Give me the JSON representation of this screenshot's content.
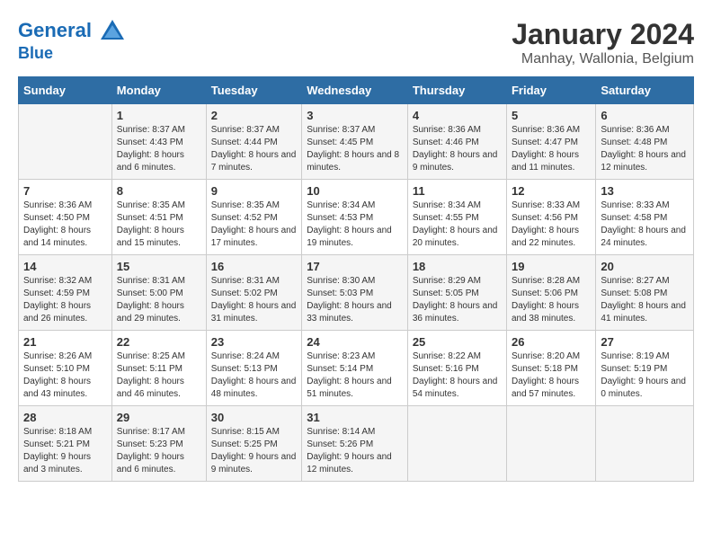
{
  "header": {
    "logo_line1": "General",
    "logo_line2": "Blue",
    "month_year": "January 2024",
    "location": "Manhay, Wallonia, Belgium"
  },
  "days_of_week": [
    "Sunday",
    "Monday",
    "Tuesday",
    "Wednesday",
    "Thursday",
    "Friday",
    "Saturday"
  ],
  "weeks": [
    [
      {
        "day": "",
        "sunrise": "",
        "sunset": "",
        "daylight": ""
      },
      {
        "day": "1",
        "sunrise": "Sunrise: 8:37 AM",
        "sunset": "Sunset: 4:43 PM",
        "daylight": "Daylight: 8 hours and 6 minutes."
      },
      {
        "day": "2",
        "sunrise": "Sunrise: 8:37 AM",
        "sunset": "Sunset: 4:44 PM",
        "daylight": "Daylight: 8 hours and 7 minutes."
      },
      {
        "day": "3",
        "sunrise": "Sunrise: 8:37 AM",
        "sunset": "Sunset: 4:45 PM",
        "daylight": "Daylight: 8 hours and 8 minutes."
      },
      {
        "day": "4",
        "sunrise": "Sunrise: 8:36 AM",
        "sunset": "Sunset: 4:46 PM",
        "daylight": "Daylight: 8 hours and 9 minutes."
      },
      {
        "day": "5",
        "sunrise": "Sunrise: 8:36 AM",
        "sunset": "Sunset: 4:47 PM",
        "daylight": "Daylight: 8 hours and 11 minutes."
      },
      {
        "day": "6",
        "sunrise": "Sunrise: 8:36 AM",
        "sunset": "Sunset: 4:48 PM",
        "daylight": "Daylight: 8 hours and 12 minutes."
      }
    ],
    [
      {
        "day": "7",
        "sunrise": "Sunrise: 8:36 AM",
        "sunset": "Sunset: 4:50 PM",
        "daylight": "Daylight: 8 hours and 14 minutes."
      },
      {
        "day": "8",
        "sunrise": "Sunrise: 8:35 AM",
        "sunset": "Sunset: 4:51 PM",
        "daylight": "Daylight: 8 hours and 15 minutes."
      },
      {
        "day": "9",
        "sunrise": "Sunrise: 8:35 AM",
        "sunset": "Sunset: 4:52 PM",
        "daylight": "Daylight: 8 hours and 17 minutes."
      },
      {
        "day": "10",
        "sunrise": "Sunrise: 8:34 AM",
        "sunset": "Sunset: 4:53 PM",
        "daylight": "Daylight: 8 hours and 19 minutes."
      },
      {
        "day": "11",
        "sunrise": "Sunrise: 8:34 AM",
        "sunset": "Sunset: 4:55 PM",
        "daylight": "Daylight: 8 hours and 20 minutes."
      },
      {
        "day": "12",
        "sunrise": "Sunrise: 8:33 AM",
        "sunset": "Sunset: 4:56 PM",
        "daylight": "Daylight: 8 hours and 22 minutes."
      },
      {
        "day": "13",
        "sunrise": "Sunrise: 8:33 AM",
        "sunset": "Sunset: 4:58 PM",
        "daylight": "Daylight: 8 hours and 24 minutes."
      }
    ],
    [
      {
        "day": "14",
        "sunrise": "Sunrise: 8:32 AM",
        "sunset": "Sunset: 4:59 PM",
        "daylight": "Daylight: 8 hours and 26 minutes."
      },
      {
        "day": "15",
        "sunrise": "Sunrise: 8:31 AM",
        "sunset": "Sunset: 5:00 PM",
        "daylight": "Daylight: 8 hours and 29 minutes."
      },
      {
        "day": "16",
        "sunrise": "Sunrise: 8:31 AM",
        "sunset": "Sunset: 5:02 PM",
        "daylight": "Daylight: 8 hours and 31 minutes."
      },
      {
        "day": "17",
        "sunrise": "Sunrise: 8:30 AM",
        "sunset": "Sunset: 5:03 PM",
        "daylight": "Daylight: 8 hours and 33 minutes."
      },
      {
        "day": "18",
        "sunrise": "Sunrise: 8:29 AM",
        "sunset": "Sunset: 5:05 PM",
        "daylight": "Daylight: 8 hours and 36 minutes."
      },
      {
        "day": "19",
        "sunrise": "Sunrise: 8:28 AM",
        "sunset": "Sunset: 5:06 PM",
        "daylight": "Daylight: 8 hours and 38 minutes."
      },
      {
        "day": "20",
        "sunrise": "Sunrise: 8:27 AM",
        "sunset": "Sunset: 5:08 PM",
        "daylight": "Daylight: 8 hours and 41 minutes."
      }
    ],
    [
      {
        "day": "21",
        "sunrise": "Sunrise: 8:26 AM",
        "sunset": "Sunset: 5:10 PM",
        "daylight": "Daylight: 8 hours and 43 minutes."
      },
      {
        "day": "22",
        "sunrise": "Sunrise: 8:25 AM",
        "sunset": "Sunset: 5:11 PM",
        "daylight": "Daylight: 8 hours and 46 minutes."
      },
      {
        "day": "23",
        "sunrise": "Sunrise: 8:24 AM",
        "sunset": "Sunset: 5:13 PM",
        "daylight": "Daylight: 8 hours and 48 minutes."
      },
      {
        "day": "24",
        "sunrise": "Sunrise: 8:23 AM",
        "sunset": "Sunset: 5:14 PM",
        "daylight": "Daylight: 8 hours and 51 minutes."
      },
      {
        "day": "25",
        "sunrise": "Sunrise: 8:22 AM",
        "sunset": "Sunset: 5:16 PM",
        "daylight": "Daylight: 8 hours and 54 minutes."
      },
      {
        "day": "26",
        "sunrise": "Sunrise: 8:20 AM",
        "sunset": "Sunset: 5:18 PM",
        "daylight": "Daylight: 8 hours and 57 minutes."
      },
      {
        "day": "27",
        "sunrise": "Sunrise: 8:19 AM",
        "sunset": "Sunset: 5:19 PM",
        "daylight": "Daylight: 9 hours and 0 minutes."
      }
    ],
    [
      {
        "day": "28",
        "sunrise": "Sunrise: 8:18 AM",
        "sunset": "Sunset: 5:21 PM",
        "daylight": "Daylight: 9 hours and 3 minutes."
      },
      {
        "day": "29",
        "sunrise": "Sunrise: 8:17 AM",
        "sunset": "Sunset: 5:23 PM",
        "daylight": "Daylight: 9 hours and 6 minutes."
      },
      {
        "day": "30",
        "sunrise": "Sunrise: 8:15 AM",
        "sunset": "Sunset: 5:25 PM",
        "daylight": "Daylight: 9 hours and 9 minutes."
      },
      {
        "day": "31",
        "sunrise": "Sunrise: 8:14 AM",
        "sunset": "Sunset: 5:26 PM",
        "daylight": "Daylight: 9 hours and 12 minutes."
      },
      {
        "day": "",
        "sunrise": "",
        "sunset": "",
        "daylight": ""
      },
      {
        "day": "",
        "sunrise": "",
        "sunset": "",
        "daylight": ""
      },
      {
        "day": "",
        "sunrise": "",
        "sunset": "",
        "daylight": ""
      }
    ]
  ]
}
